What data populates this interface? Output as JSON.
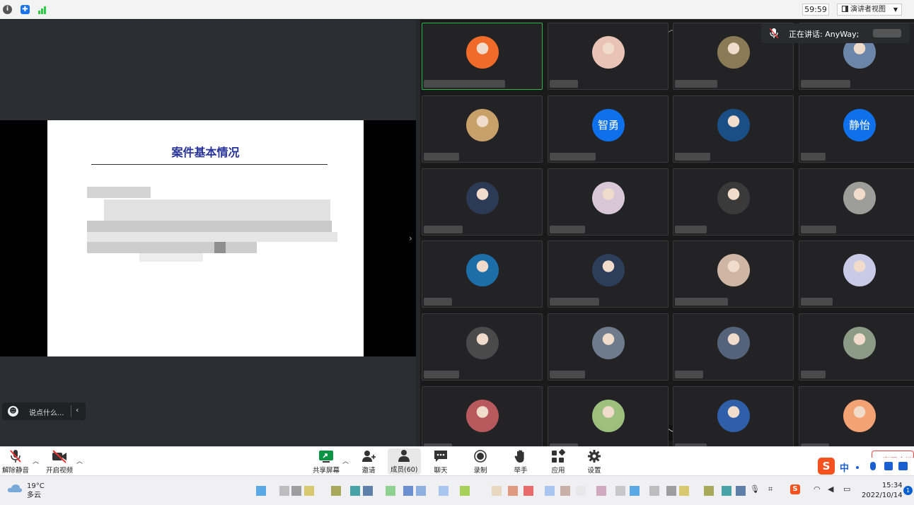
{
  "topbar": {
    "timer": "59:59",
    "view_label": "演讲者视图",
    "icons": [
      "info-icon",
      "shield-icon",
      "signal-strength-icon"
    ]
  },
  "slide": {
    "title": "案件基本情况"
  },
  "chat": {
    "placeholder": "说点什么..."
  },
  "speaking": {
    "text": "正在讲话: AnyWay;"
  },
  "gallery": {
    "tiles": [
      {
        "type": "image",
        "color": "#f06b2a",
        "active": true
      },
      {
        "type": "image",
        "color": "#e8c3b6"
      },
      {
        "type": "image",
        "color": "#8a7a55"
      },
      {
        "type": "image",
        "color": "#6b86a8"
      },
      {
        "type": "image",
        "color": "#c8a069"
      },
      {
        "type": "text",
        "text": "智勇",
        "color": "#0e71eb"
      },
      {
        "type": "image",
        "color": "#1a4f86"
      },
      {
        "type": "text",
        "text": "静怡",
        "color": "#0e71eb"
      },
      {
        "type": "image",
        "color": "#2d3a55"
      },
      {
        "type": "image",
        "color": "#d9c7d8"
      },
      {
        "type": "image",
        "color": "#3a3a3a"
      },
      {
        "type": "image",
        "color": "#9d9d99"
      },
      {
        "type": "image",
        "color": "#1b6ea8"
      },
      {
        "type": "image",
        "color": "#2c3e5a"
      },
      {
        "type": "image",
        "color": "#cfb6a4"
      },
      {
        "type": "image",
        "color": "#c9cbe6"
      },
      {
        "type": "image",
        "color": "#4a4a4a"
      },
      {
        "type": "image",
        "color": "#6d7b8c"
      },
      {
        "type": "image",
        "color": "#54627a"
      },
      {
        "type": "image",
        "color": "#8b9b86"
      },
      {
        "type": "image",
        "color": "#b8595d"
      },
      {
        "type": "image",
        "color": "#9ec07e"
      },
      {
        "type": "image",
        "color": "#2f5fa8"
      },
      {
        "type": "image",
        "color": "#f2a273"
      }
    ]
  },
  "toolbar": {
    "unmute": "解除静音",
    "start_video": "开启视频",
    "share_screen": "共享屏幕",
    "invite": "邀请",
    "participants": "成员(60)",
    "chat": "聊天",
    "record": "录制",
    "raise_hand": "举手",
    "apps": "应用",
    "settings": "设置",
    "end_meeting": "离开会议"
  },
  "ime": {
    "mode": "中"
  },
  "taskbar": {
    "temperature": "19°C",
    "weather": "多云",
    "time": "15:34",
    "date": "2022/10/14",
    "notification_count": "1"
  }
}
